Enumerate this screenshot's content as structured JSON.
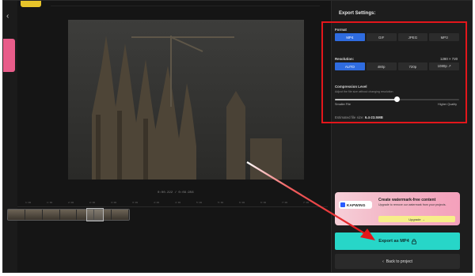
{
  "panel": {
    "title": "Export Settings:",
    "format": {
      "label": "Format",
      "options": [
        "MP4",
        "GIF",
        "JPEG",
        "MP3"
      ],
      "selected": "MP4"
    },
    "resolution": {
      "label": "Resolution:",
      "value": "1280 × 720",
      "options": [
        "AUTO",
        "480p",
        "720p",
        "1080p ↗"
      ],
      "selected": "AUTO"
    },
    "compression": {
      "label": "Compression Level",
      "hint": "Adjust the file size without changing resolution",
      "min_label": "Smaller File",
      "max_label": "Higher Quality",
      "level": 0.5
    },
    "filesize": {
      "prefix": "Estimated file size:",
      "value": "6.4-23.5MB"
    },
    "upsell": {
      "logo_text": "KAPWING",
      "title": "Create watermark-free content",
      "body": "Upgrade to remove our watermark from your projects.",
      "button": "Upgrade →"
    },
    "export_button": "Export as MP4",
    "back_button": "Back to project"
  },
  "timeline": {
    "timecode": "0:00.222 / 0:09.956",
    "ticks": [
      "1:00",
      "1:30",
      "2:00",
      "2:30",
      "3:00",
      "3:30",
      "4:00",
      "4:30",
      "5:00",
      "5:30",
      "6:00",
      "6:30",
      "7:00",
      "7:30"
    ]
  },
  "colors": {
    "accent": "#2f6ce0",
    "export": "#27d6c8",
    "highlight": "#e3161b"
  },
  "icons": {
    "back": "chevron-left-icon",
    "export": "lock-icon",
    "back_to_project": "chevron-left-icon"
  }
}
